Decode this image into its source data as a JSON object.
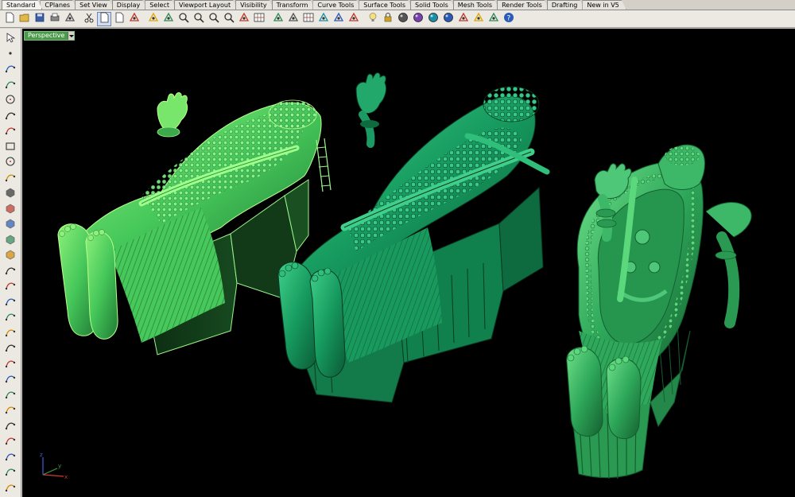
{
  "tabs": [
    {
      "label": "Standard",
      "active": true
    },
    {
      "label": "CPlanes",
      "active": false
    },
    {
      "label": "Set View",
      "active": false
    },
    {
      "label": "Display",
      "active": false
    },
    {
      "label": "Select",
      "active": false
    },
    {
      "label": "Viewport Layout",
      "active": false
    },
    {
      "label": "Visibility",
      "active": false
    },
    {
      "label": "Transform",
      "active": false
    },
    {
      "label": "Curve Tools",
      "active": false
    },
    {
      "label": "Surface Tools",
      "active": false
    },
    {
      "label": "Solid Tools",
      "active": false
    },
    {
      "label": "Mesh Tools",
      "active": false
    },
    {
      "label": "Render Tools",
      "active": false
    },
    {
      "label": "Drafting",
      "active": false
    },
    {
      "label": "New in V5",
      "active": false
    }
  ],
  "toolbar_icons": [
    "new-file-icon",
    "open-folder-icon",
    "save-icon",
    "print-icon",
    "import-icon",
    "cut-icon",
    "copy-icon",
    "paste-icon",
    "undo-icon",
    "pan-hand-icon",
    "move-cross-icon",
    "zoom-in-icon",
    "zoom-window-icon",
    "zoom-extents-icon",
    "zoom-selected-icon",
    "rotate-view-icon",
    "grid-icon",
    "viewport-layout-icon",
    "named-view-icon",
    "grid-snap-icon",
    "osnap-icon",
    "cplane-icon",
    "cplane-view-icon",
    "bulb-icon",
    "lock-icon",
    "color-wheel-icon",
    "material-icon",
    "render-sphere-icon",
    "shaded-sphere-icon",
    "render-preview-icon",
    "lasso-icon",
    "options-icon",
    "help-icon"
  ],
  "left_tools": [
    "select-arrow-icon",
    "point-icon",
    "polyline-icon",
    "curve-icon",
    "circle-icon",
    "arc-icon",
    "polygon-icon",
    "rectangle-icon",
    "ellipse-icon",
    "freeform-icon",
    "surface-icon",
    "extrude-icon",
    "box-solid-icon",
    "sphere-icon",
    "cylinder-icon",
    "mesh-icon",
    "boolean-icon",
    "edit-points-icon",
    "rebuild-icon",
    "dimension-icon",
    "text-icon",
    "fillet-icon",
    "split-icon",
    "trim-icon",
    "join-icon",
    "explode-icon",
    "array-icon",
    "group-icon",
    "block-icon",
    "render-icon",
    "more-chevron-icon"
  ],
  "viewport": {
    "label": "Perspective",
    "background": "#000000",
    "models": [
      {
        "name": "Reclining figure 1",
        "color": "#5fd96b",
        "edge": "#b9ff8a"
      },
      {
        "name": "Reclining figure 2",
        "color": "#1c9a63",
        "edge": "#2f7a55"
      },
      {
        "name": "Reclining figure 3",
        "color": "#33b060",
        "edge": "#1d6a3a"
      }
    ]
  },
  "axes": {
    "x": "x",
    "y": "y",
    "z": "z",
    "x_color": "#d63a2f",
    "y_color": "#3f9a3f",
    "z_color": "#3f5fd8"
  },
  "colors": {
    "ui_bg": "#d4d0c8",
    "accent": "#4a9a4a"
  }
}
